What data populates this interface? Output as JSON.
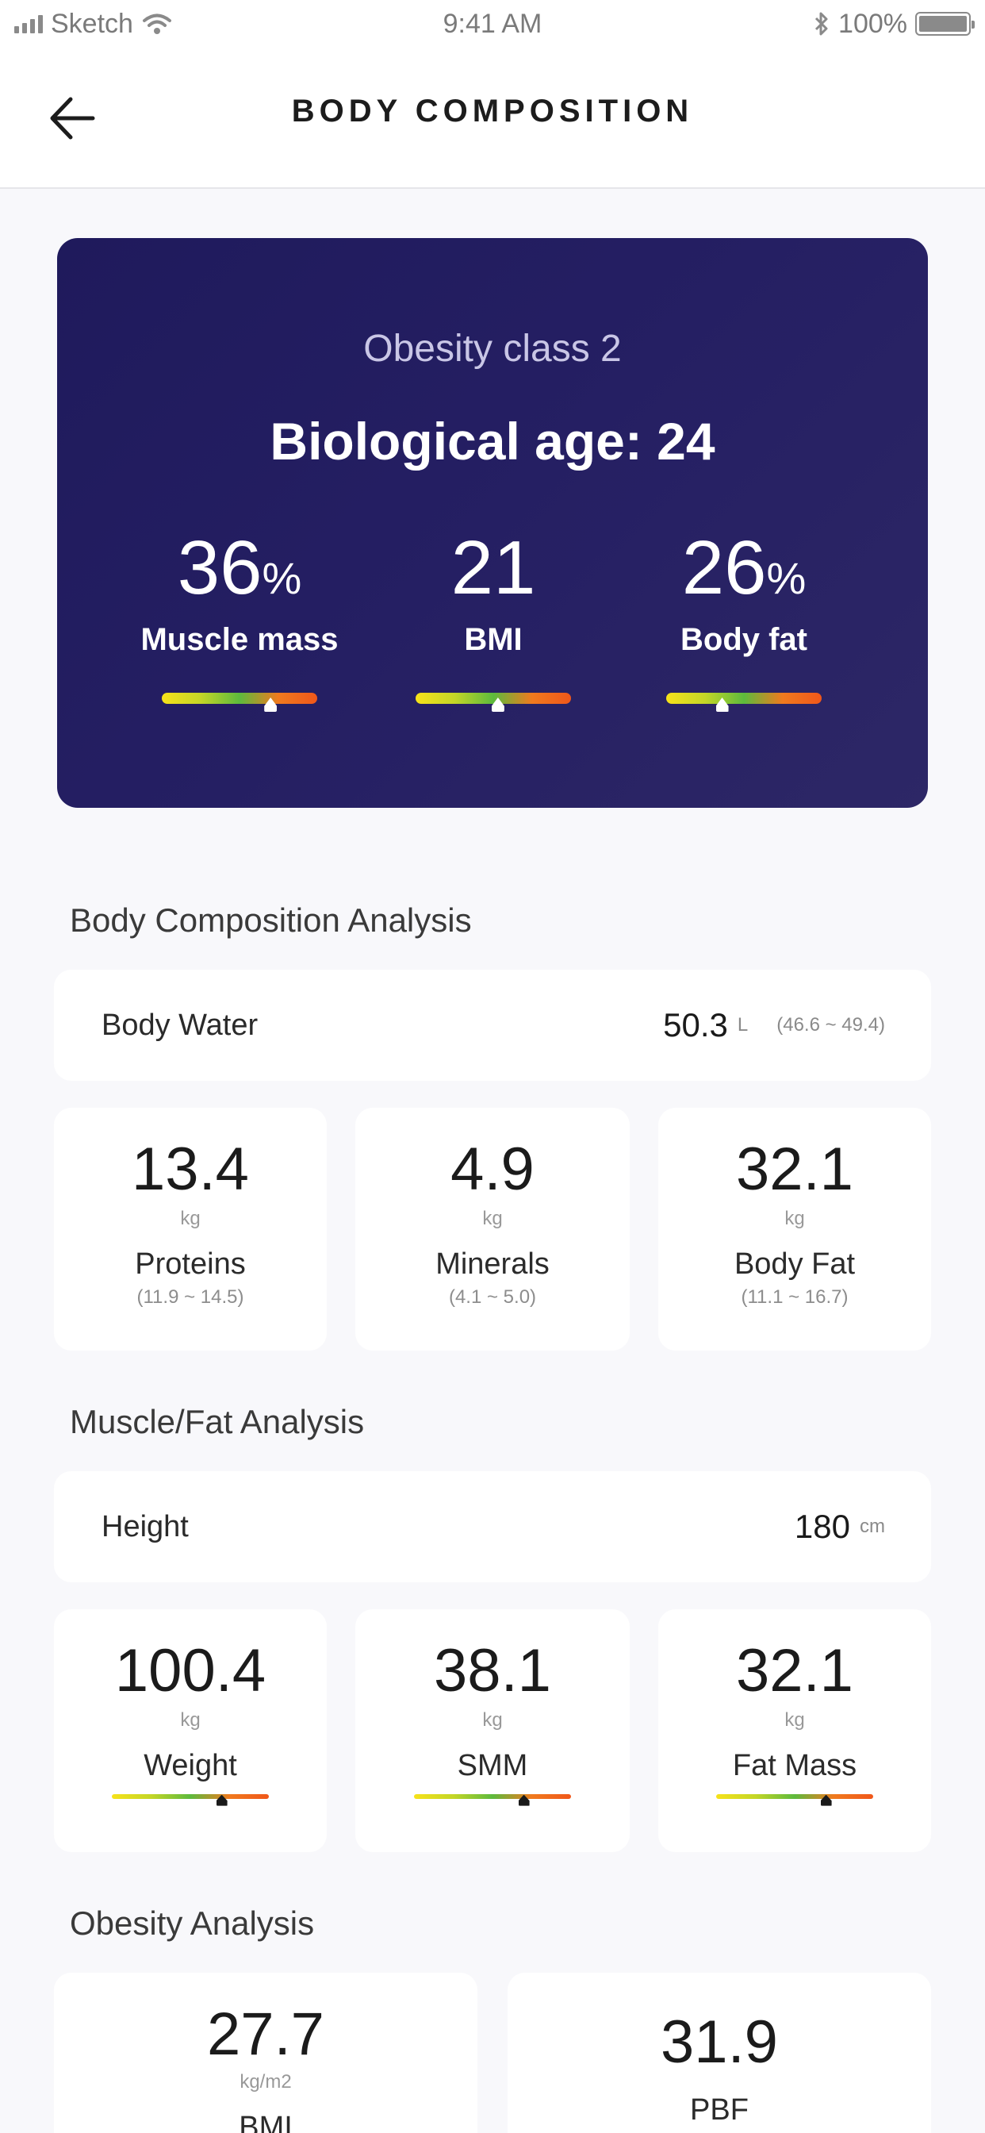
{
  "status_bar": {
    "carrier": "Sketch",
    "time": "9:41 AM",
    "battery": "100%",
    "signal_icon": "signal-bars-icon",
    "wifi_icon": "wifi-icon",
    "bluetooth_icon": "bluetooth-icon",
    "battery_icon": "battery-icon"
  },
  "header": {
    "title": "BODY COMPOSITION",
    "back_icon": "back-arrow-icon"
  },
  "summary": {
    "classification": "Obesity class 2",
    "biological_age": "Biological age: 24",
    "stats": [
      {
        "value": "36",
        "unit": "%",
        "label": "Muscle mass",
        "level": 0.7
      },
      {
        "value": "21",
        "unit": "",
        "label": "BMI",
        "level": 0.53
      },
      {
        "value": "26",
        "unit": "%",
        "label": "Body fat",
        "level": 0.36
      }
    ]
  },
  "body_composition": {
    "title": "Body Composition Analysis",
    "water": {
      "label": "Body Water",
      "value": "50.3",
      "unit": "L",
      "range": "(46.6 ~ 49.4)"
    },
    "metrics": [
      {
        "value": "13.4",
        "unit": "kg",
        "label": "Proteins",
        "range": "(11.9 ~ 14.5)"
      },
      {
        "value": "4.9",
        "unit": "kg",
        "label": "Minerals",
        "range": "(4.1 ~ 5.0)"
      },
      {
        "value": "32.1",
        "unit": "kg",
        "label": "Body Fat",
        "range": "(11.1 ~ 16.7)"
      }
    ]
  },
  "muscle_fat": {
    "title": "Muscle/Fat Analysis",
    "height": {
      "label": "Height",
      "value": "180",
      "unit": "cm"
    },
    "metrics": [
      {
        "value": "100.4",
        "unit": "kg",
        "label": "Weight",
        "level": 0.7
      },
      {
        "value": "38.1",
        "unit": "kg",
        "label": "SMM",
        "level": 0.7
      },
      {
        "value": "32.1",
        "unit": "kg",
        "label": "Fat Mass",
        "level": 0.7
      }
    ]
  },
  "obesity": {
    "title": "Obesity Analysis",
    "metrics": [
      {
        "value": "27.7",
        "unit": "kg/m2",
        "label": "BMI"
      },
      {
        "value": "31.9",
        "unit": "",
        "label": "PBF"
      }
    ]
  },
  "colors": {
    "hero_start": "#1f1a5c",
    "hero_end": "#2d2766",
    "scale_yellow": "#f7e21a",
    "scale_green": "#5dba3d",
    "scale_orange": "#f0571a"
  }
}
